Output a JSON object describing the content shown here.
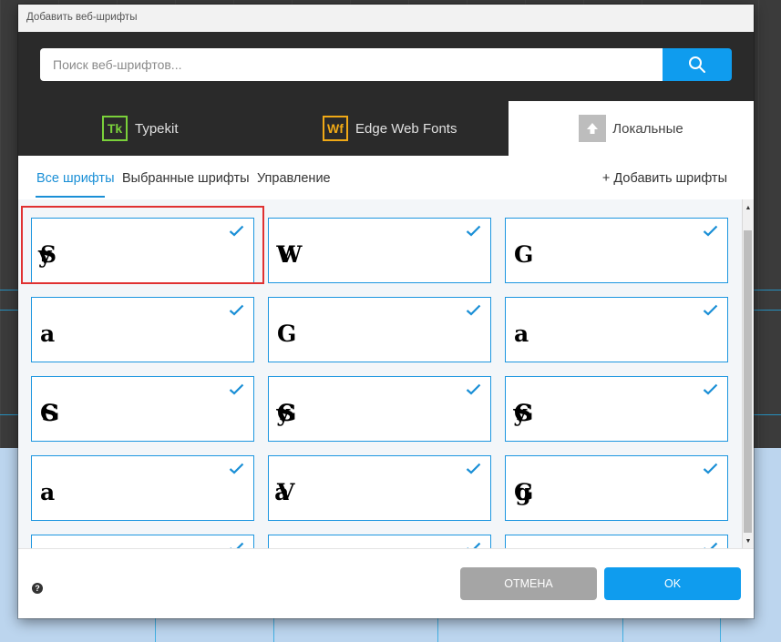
{
  "dialog": {
    "title": "Добавить веб-шрифты"
  },
  "search": {
    "placeholder": "Поиск веб-шрифтов...",
    "value": "",
    "icon": "search-icon"
  },
  "providers": [
    {
      "logo": "Tk",
      "label": "Typekit",
      "logo_color": "#7ad13a",
      "active": false
    },
    {
      "logo": "Wf",
      "label": "Edge Web Fonts",
      "logo_color": "#f0a916",
      "active": false
    },
    {
      "logo": "upload-icon",
      "label": "Локальные",
      "active": true
    }
  ],
  "subtabs": [
    {
      "label": "Все шрифты",
      "active": true
    },
    {
      "label": "Выбранные шрифты",
      "active": false
    },
    {
      "label": "Управление",
      "active": false
    }
  ],
  "add_fonts_label": "+ Добавить шрифты",
  "font_cards": [
    {
      "preview": "Sy",
      "selected": true
    },
    {
      "preview": "VW",
      "selected": true
    },
    {
      "preview": "G",
      "selected": true
    },
    {
      "preview": "a",
      "selected": true
    },
    {
      "preview": "G",
      "selected": true
    },
    {
      "preview": "a",
      "selected": true
    },
    {
      "preview": "GS",
      "selected": true
    },
    {
      "preview": "GSy",
      "selected": true
    },
    {
      "preview": "GSy",
      "selected": true
    },
    {
      "preview": "a",
      "selected": true
    },
    {
      "preview": "Va",
      "selected": true
    },
    {
      "preview": "Gg",
      "selected": true
    },
    {
      "preview": "",
      "selected": true
    },
    {
      "preview": "",
      "selected": true
    },
    {
      "preview": "",
      "selected": true
    }
  ],
  "footer": {
    "help_label": "?",
    "cancel_label": "ОТМЕНА",
    "ok_label": "OK"
  },
  "colors": {
    "accent": "#0f9cee",
    "highlight": "#e03131",
    "header_bg": "#2a2a2a"
  }
}
